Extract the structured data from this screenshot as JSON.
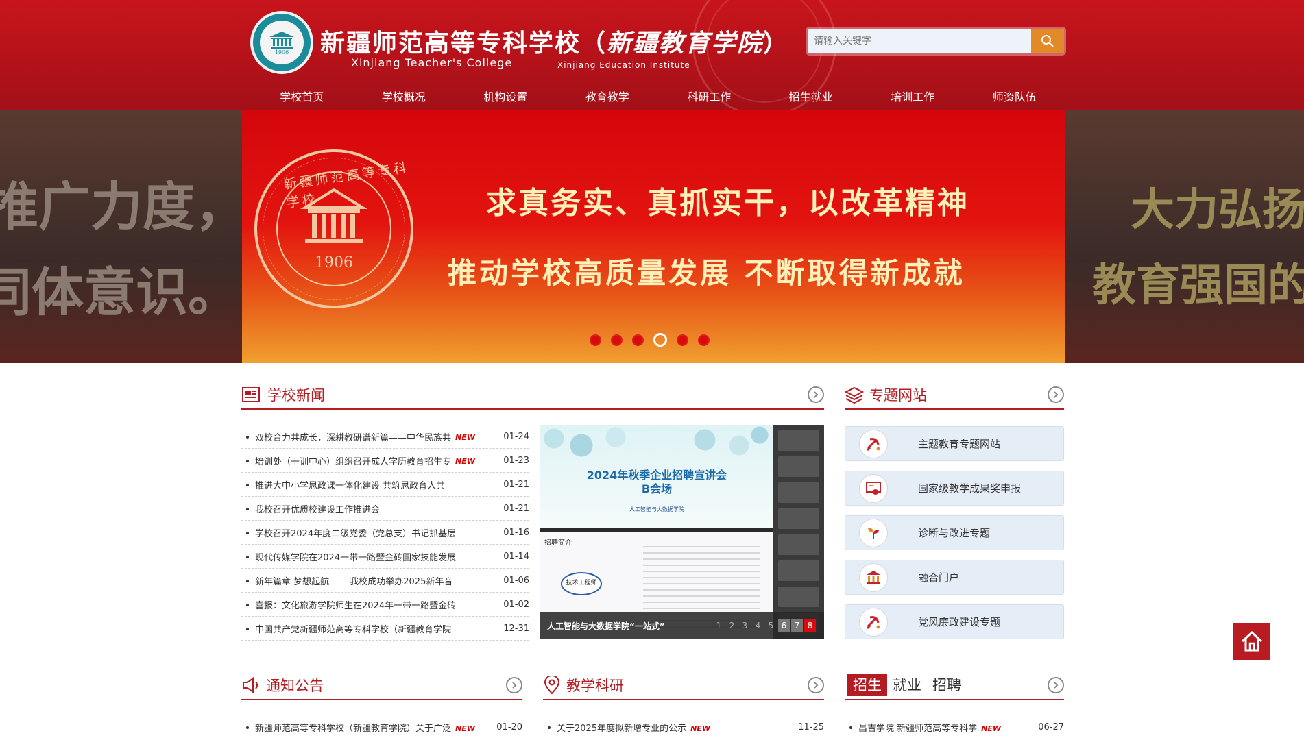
{
  "header": {
    "school_cn": "新疆师范高等专科学校（",
    "school_cn_script": "新疆教育学院",
    "school_cn_close": "）",
    "school_en": "Xinjiang  Teacher's  College",
    "school_en2": "Xinjiang Education Institute",
    "logo_year": "1906",
    "search_placeholder": "请输入关键字",
    "nav": [
      "学校首页",
      "学校概况",
      "机构设置",
      "教育教学",
      "科研工作",
      "招生就业",
      "培训工作",
      "师资队伍"
    ]
  },
  "banner": {
    "left_line1": "推广力度，",
    "left_line2": "同体意识。",
    "right_line1": "大力弘扬",
    "right_line2": "教育强国的",
    "seal_ring": "新疆师范高等专科学校",
    "seal_year": "1906",
    "line1": "求真务实、真抓实干，以改革精神",
    "line2": "推动学校高质量发展 不断取得新成就",
    "dots": 6,
    "active_dot": 3
  },
  "news": {
    "title": "学校新闻",
    "new_label": "NEW",
    "items": [
      {
        "title": "双校合力共成长，深耕教研谱新篇——中华民族共",
        "date": "01-24",
        "new": true
      },
      {
        "title": "培训处（干训中心）组织召开成人学历教育招生专",
        "date": "01-23",
        "new": true
      },
      {
        "title": "推进大中小学思政课一体化建设 共筑思政育人共",
        "date": "01-21",
        "new": false
      },
      {
        "title": "我校召开优质校建设工作推进会",
        "date": "01-21",
        "new": false
      },
      {
        "title": "学校召开2024年度二级党委（党总支）书记抓基层",
        "date": "01-16",
        "new": false
      },
      {
        "title": "现代传媒学院在2024一带一路暨金砖国家技能发展",
        "date": "01-14",
        "new": false
      },
      {
        "title": "新年篇章 梦想起航 ——我校成功举办2025新年音",
        "date": "01-06",
        "new": false
      },
      {
        "title": "喜报：文化旅游学院师生在2024年一带一路暨金砖",
        "date": "01-02",
        "new": false
      },
      {
        "title": "中国共产党新疆师范高等专科学校（新疆教育学院",
        "date": "12-31",
        "new": false
      }
    ]
  },
  "photo": {
    "h1": "2024年秋季企业招聘宣讲会",
    "h2": "B会场",
    "h3": "人工智能与大数据学院",
    "slide_tag": "招聘简介",
    "ellipse_text": "技术工程师",
    "caption": "人工智能与大数据学院“一站式”",
    "pager": [
      "1",
      "2",
      "3",
      "4",
      "5",
      "6",
      "7",
      "8"
    ]
  },
  "topics": {
    "title": "专题网站",
    "items": [
      {
        "label": "主题教育专题网站",
        "icon": "party-emblem-icon"
      },
      {
        "label": "国家级教学成果奖申报",
        "icon": "award-certificate-icon"
      },
      {
        "label": "诊断与改进专题",
        "icon": "plant-growth-icon"
      },
      {
        "label": "融合门户",
        "icon": "institution-building-icon"
      },
      {
        "label": "党风廉政建设专题",
        "icon": "party-emblem-icon"
      }
    ]
  },
  "notice": {
    "title": "通知公告",
    "items": [
      {
        "title": "新疆师范高等专科学校（新疆教育学院）关于广泛",
        "date": "01-20",
        "new": true
      }
    ]
  },
  "research": {
    "title": "教学科研",
    "items": [
      {
        "title": "关于2025年度拟新增专业的公示",
        "date": "11-25",
        "new": true
      }
    ]
  },
  "recruit": {
    "tabs": [
      "招生",
      "就业",
      "招聘"
    ],
    "active_tab": 0,
    "items": [
      {
        "title": "昌吉学院 新疆师范高等专科学",
        "date": "06-27",
        "new": true
      }
    ]
  },
  "colors": {
    "brand_red": "#b31c22",
    "header_red": "#c8141c",
    "search_orange": "#e38a28",
    "topic_bg": "#e5edf7"
  }
}
